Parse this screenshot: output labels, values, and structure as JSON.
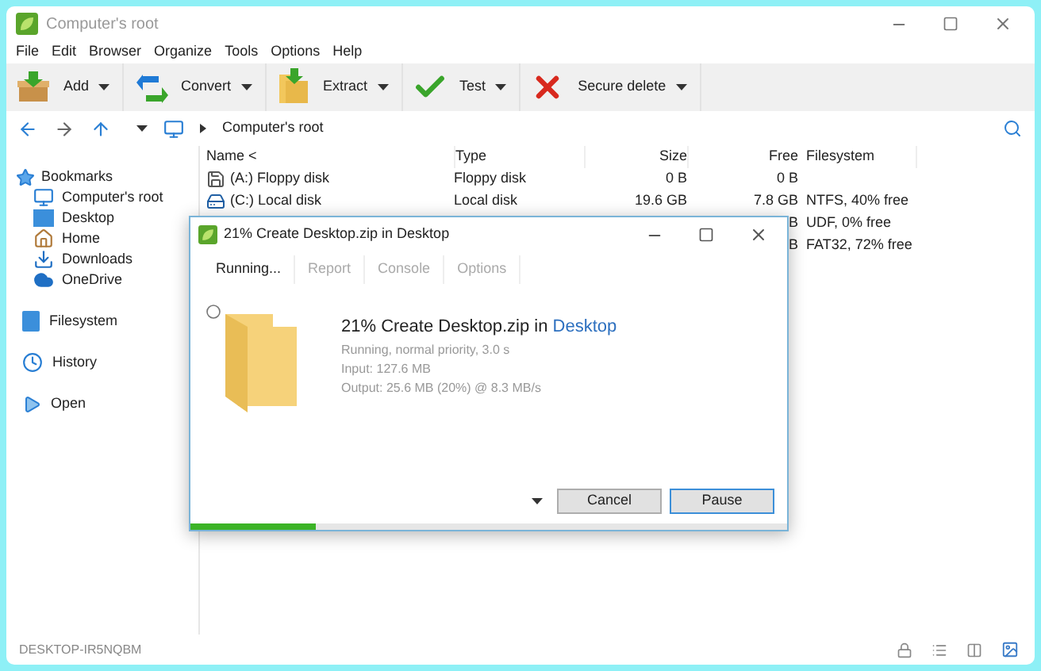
{
  "window": {
    "title": "Computer's root"
  },
  "menu": [
    "File",
    "Edit",
    "Browser",
    "Organize",
    "Tools",
    "Options",
    "Help"
  ],
  "toolbar": [
    {
      "label": "Add"
    },
    {
      "label": "Convert"
    },
    {
      "label": "Extract"
    },
    {
      "label": "Test"
    },
    {
      "label": "Secure delete"
    }
  ],
  "address": {
    "path": "Computer's root"
  },
  "sidebar": {
    "bookmarks": {
      "label": "Bookmarks",
      "children": [
        {
          "label": "Computer's root"
        },
        {
          "label": "Desktop"
        },
        {
          "label": "Home"
        },
        {
          "label": "Downloads"
        },
        {
          "label": "OneDrive"
        }
      ]
    },
    "sections": [
      {
        "label": "Filesystem"
      },
      {
        "label": "History"
      },
      {
        "label": "Open"
      }
    ]
  },
  "table": {
    "columns": [
      "Name <",
      "Type",
      "Size",
      "Free",
      "Filesystem"
    ],
    "rows": [
      {
        "name": "(A:) Floppy disk",
        "type": "Floppy disk",
        "size": "0 B",
        "free": "0 B",
        "filesystem": ""
      },
      {
        "name": "(C:) Local disk",
        "type": "Local disk",
        "size": "19.6 GB",
        "free": "7.8 GB",
        "filesystem": "NTFS, 40% free"
      },
      {
        "name": "",
        "type": "",
        "size": "",
        "free": "B",
        "filesystem": "UDF, 0% free"
      },
      {
        "name": "",
        "type": "",
        "size": "",
        "free": "B",
        "filesystem": "FAT32, 72% free"
      }
    ]
  },
  "dialog": {
    "title": "21% Create Desktop.zip in Desktop",
    "tabs": [
      {
        "label": "Running...",
        "selected": true
      },
      {
        "label": "Report",
        "selected": false
      },
      {
        "label": "Console",
        "selected": false
      },
      {
        "label": "Options",
        "selected": false
      }
    ],
    "heading": "21% Create Desktop.zip in",
    "heading_link": "Desktop",
    "details": [
      "Running, normal priority, 3.0 s",
      "Input: 127.6 MB",
      "Output: 25.6 MB (20%) @ 8.3 MB/s"
    ],
    "buttons": [
      {
        "label": "Cancel",
        "selected": false
      },
      {
        "label": "Pause",
        "selected": true
      }
    ],
    "progress": {
      "level": 0.21
    }
  },
  "status_bar": {
    "computer": "DESKTOP-IR5NQBM"
  }
}
